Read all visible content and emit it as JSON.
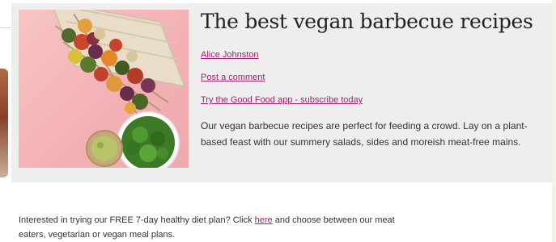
{
  "article": {
    "title": "The best vegan barbecue recipes",
    "author_link": "Alice Johnston",
    "comment_link": "Post a comment",
    "app_link": "Try the Good Food app - subscribe today",
    "description": "Our vegan barbecue recipes are perfect for feeding a crowd. Lay on a plant-based feast with our summery salads, sides and moreish meat-free mains."
  },
  "promo": {
    "text_before": "Interested in trying our FREE 7-day healthy diet plan? Click ",
    "link_text": "here",
    "text_after": " and choose between our meat eaters, vegetarian or vegan meal plans."
  },
  "colors": {
    "hero_background": "#eeeeee",
    "link": "#a3216e",
    "image_background": "#f3b1b6"
  }
}
